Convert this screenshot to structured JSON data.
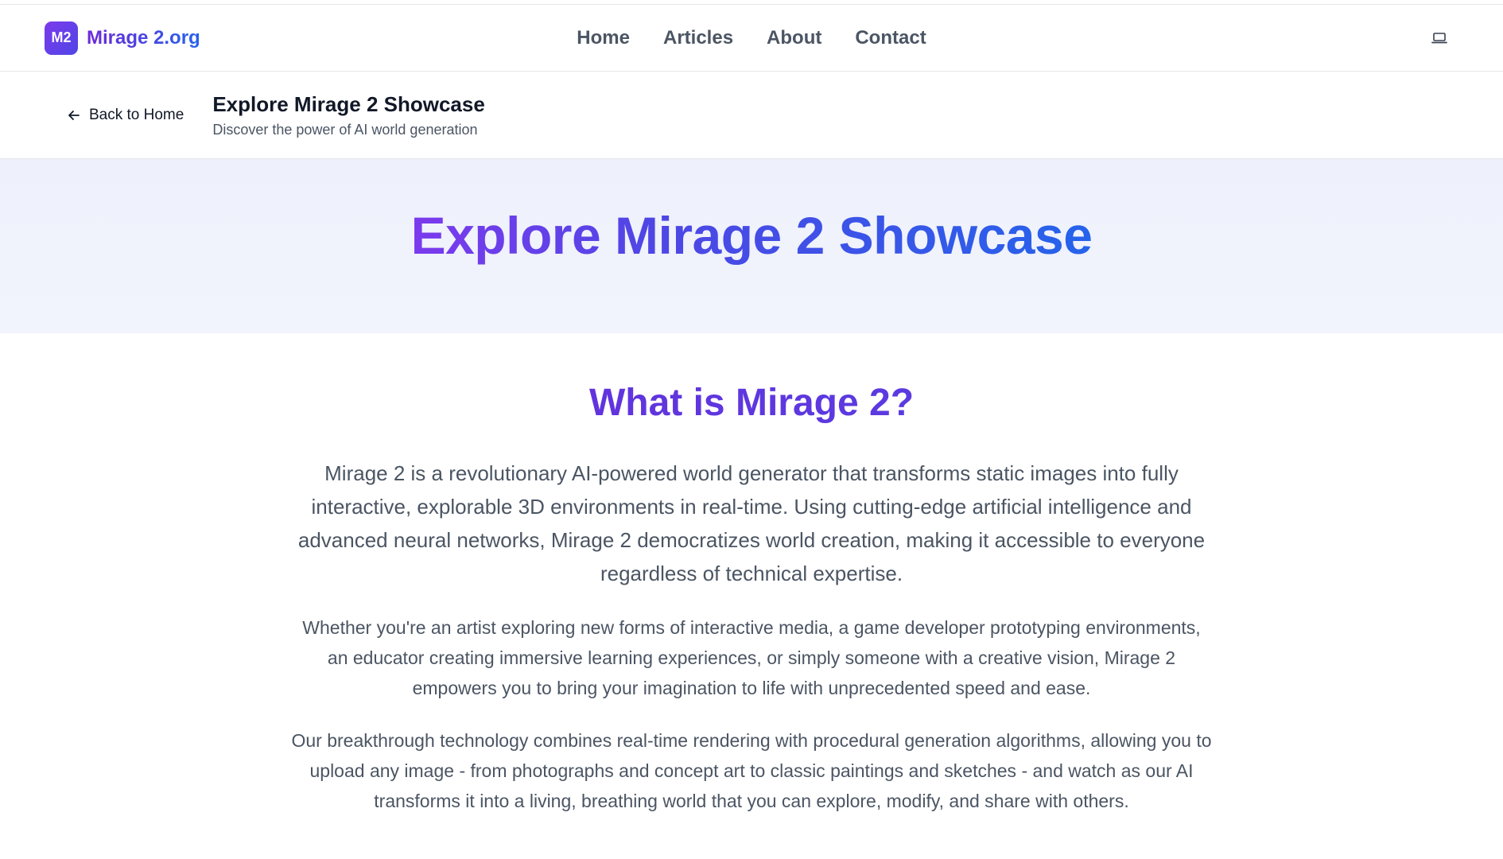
{
  "brand": {
    "logo_text": "M2",
    "name": "Mirage 2.org"
  },
  "nav": {
    "items": [
      "Home",
      "Articles",
      "About",
      "Contact"
    ]
  },
  "header_actions": {
    "device_icon": "laptop-icon"
  },
  "subheader": {
    "back_label": "Back to Home",
    "title": "Explore Mirage 2 Showcase",
    "description": "Discover the power of AI world generation"
  },
  "hero": {
    "title": "Explore Mirage 2 Showcase"
  },
  "section": {
    "title": "What is Mirage 2?",
    "paragraphs": [
      "Mirage 2 is a revolutionary AI-powered world generator that transforms static images into fully interactive, explorable 3D environments in real-time. Using cutting-edge artificial intelligence and advanced neural networks, Mirage 2 democratizes world creation, making it accessible to everyone regardless of technical expertise.",
      "Whether you're an artist exploring new forms of interactive media, a game developer prototyping environments, an educator creating immersive learning experiences, or simply someone with a creative vision, Mirage 2 empowers you to bring your imagination to life with unprecedented speed and ease.",
      "Our breakthrough technology combines real-time rendering with procedural generation algorithms, allowing you to upload any image - from photographs and concept art to classic paintings and sketches - and watch as our AI transforms it into a living, breathing world that you can explore, modify, and share with others."
    ]
  },
  "colors": {
    "accent_purple": "#7c3aed",
    "accent_blue": "#2563eb",
    "hero_bg": "#eef0fb"
  }
}
